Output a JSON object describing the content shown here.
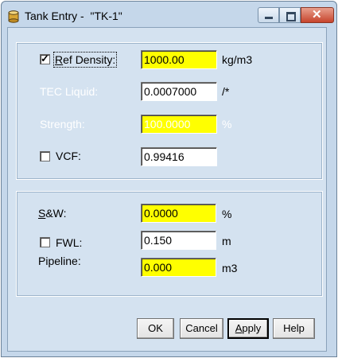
{
  "window": {
    "title": "Tank Entry -  \"TK-1\""
  },
  "density": {
    "label_prefix": "",
    "label_accel": "R",
    "label_rest": "ef Density:",
    "checked": true,
    "value": "1000.00",
    "unit": "kg/m3"
  },
  "tec": {
    "label": "TEC Liquid:",
    "value": "0.0007000",
    "unit": "/*"
  },
  "strength": {
    "label": "Strength:",
    "value": "100.0000",
    "unit": "%"
  },
  "vcf": {
    "label": "VCF:",
    "checked": false,
    "value": "0.99416"
  },
  "sw": {
    "label_accel": "S",
    "label_rest": "&W:",
    "value": "0.0000",
    "unit": "%"
  },
  "fwl": {
    "label": "FWL:",
    "checked": false,
    "value": "0.150",
    "unit": "m"
  },
  "pipeline": {
    "label": "Pipeline:",
    "value": "0.000",
    "unit": "m3"
  },
  "buttons": {
    "ok": "OK",
    "cancel": "Cancel",
    "apply_accel": "A",
    "apply_rest": "pply",
    "help": "Help"
  }
}
